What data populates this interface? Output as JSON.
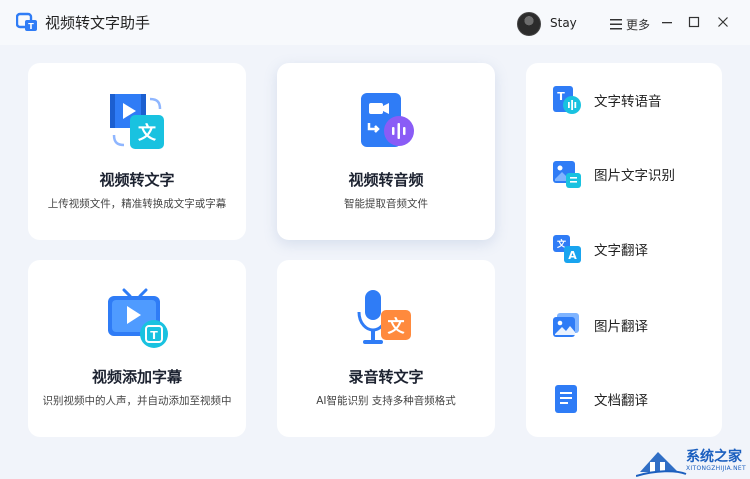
{
  "app": {
    "title": "视频转文字助手",
    "username": "Stay",
    "more_label": "更多"
  },
  "cards": [
    {
      "title": "视频转文字",
      "subtitle": "上传视频文件，精准转换成文字或字幕",
      "icon": "video-to-text-icon"
    },
    {
      "title": "视频转音频",
      "subtitle": "智能提取音频文件",
      "icon": "video-to-audio-icon"
    },
    {
      "title": "视频添加字幕",
      "subtitle": "识别视频中的人声，并自动添加至视频中",
      "icon": "add-subtitle-icon"
    },
    {
      "title": "录音转文字",
      "subtitle": "AI智能识别 支持多种音频格式",
      "icon": "audio-to-text-icon"
    }
  ],
  "side_items": [
    {
      "label": "文字转语音",
      "icon": "text-to-speech-icon"
    },
    {
      "label": "图片文字识别",
      "icon": "image-ocr-icon"
    },
    {
      "label": "文字翻译",
      "icon": "text-translate-icon"
    },
    {
      "label": "图片翻译",
      "icon": "image-translate-icon"
    },
    {
      "label": "文档翻译",
      "icon": "document-translate-icon"
    }
  ],
  "watermark": {
    "text": "系统之家",
    "url": "XITONGZHIJIA.NET"
  },
  "colors": {
    "accent_blue": "#1f8bff",
    "accent_purple": "#8a5cf6",
    "accent_orange": "#ff8a3d",
    "background": "#f1f4fa"
  }
}
